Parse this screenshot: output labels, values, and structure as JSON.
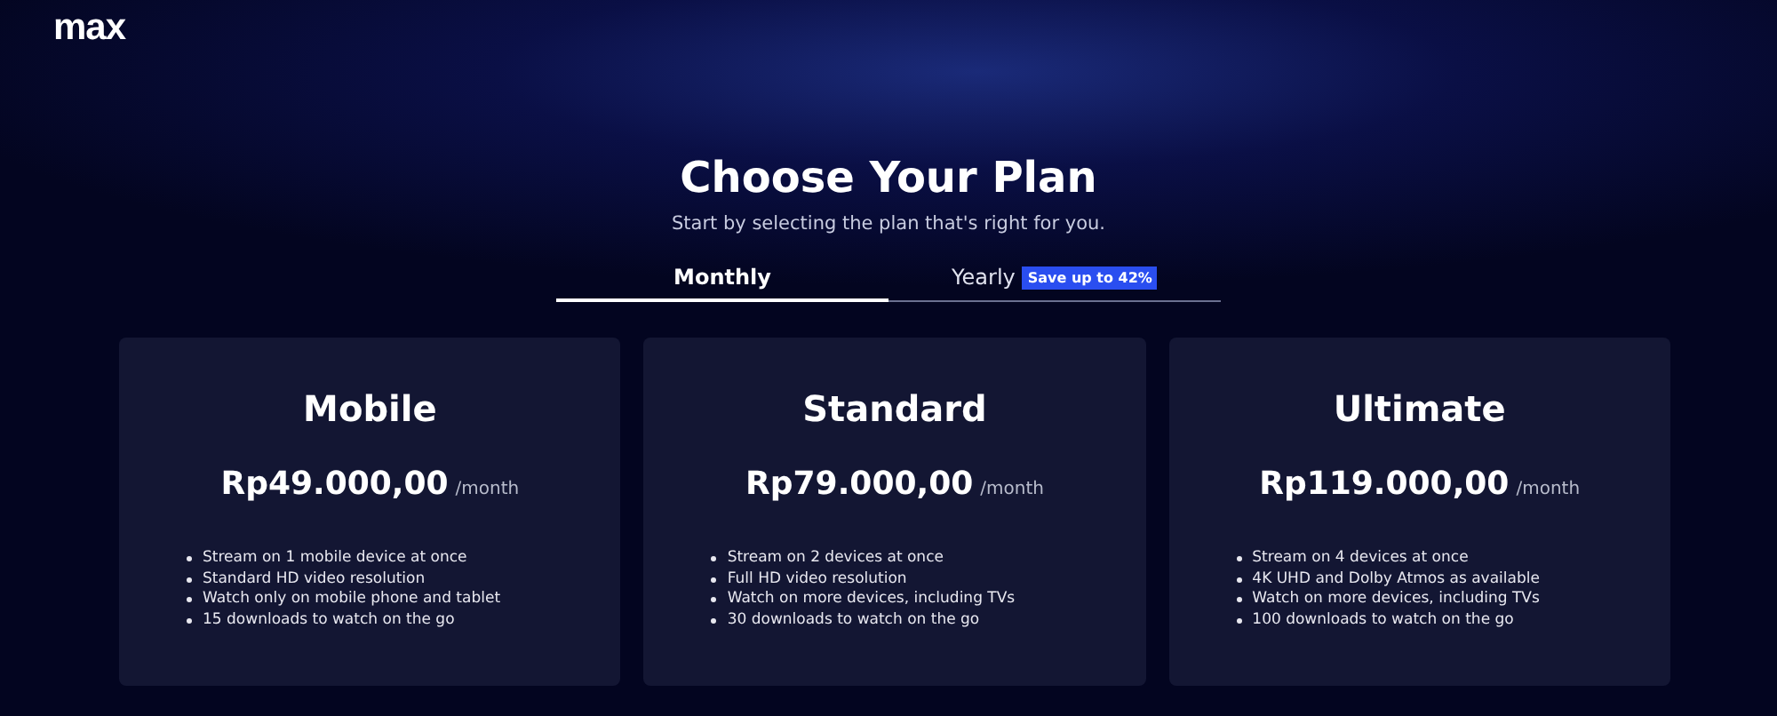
{
  "logo": "max",
  "title": "Choose Your Plan",
  "subtitle": "Start by selecting the plan that's right for you.",
  "tabs": [
    {
      "label": "Monthly",
      "selected": true
    },
    {
      "label": "Yearly",
      "selected": false,
      "badge": "Save up to 42%"
    }
  ],
  "plans": [
    {
      "name": "Mobile",
      "price": "Rp49.000,00",
      "period": "/month",
      "features": [
        "Stream on 1 mobile device at once",
        "Standard HD video resolution",
        "Watch only on mobile phone and tablet",
        "15 downloads to watch on the go"
      ]
    },
    {
      "name": "Standard",
      "price": "Rp79.000,00",
      "period": "/month",
      "features": [
        "Stream on 2 devices at once",
        "Full HD video resolution",
        "Watch on more devices, including TVs",
        "30 downloads to watch on the go"
      ]
    },
    {
      "name": "Ultimate",
      "price": "Rp119.000,00",
      "period": "/month",
      "features": [
        "Stream on 4 devices at once",
        "4K UHD and Dolby Atmos as available",
        "Watch on more devices, including TVs",
        "100 downloads to watch on the go"
      ]
    }
  ]
}
